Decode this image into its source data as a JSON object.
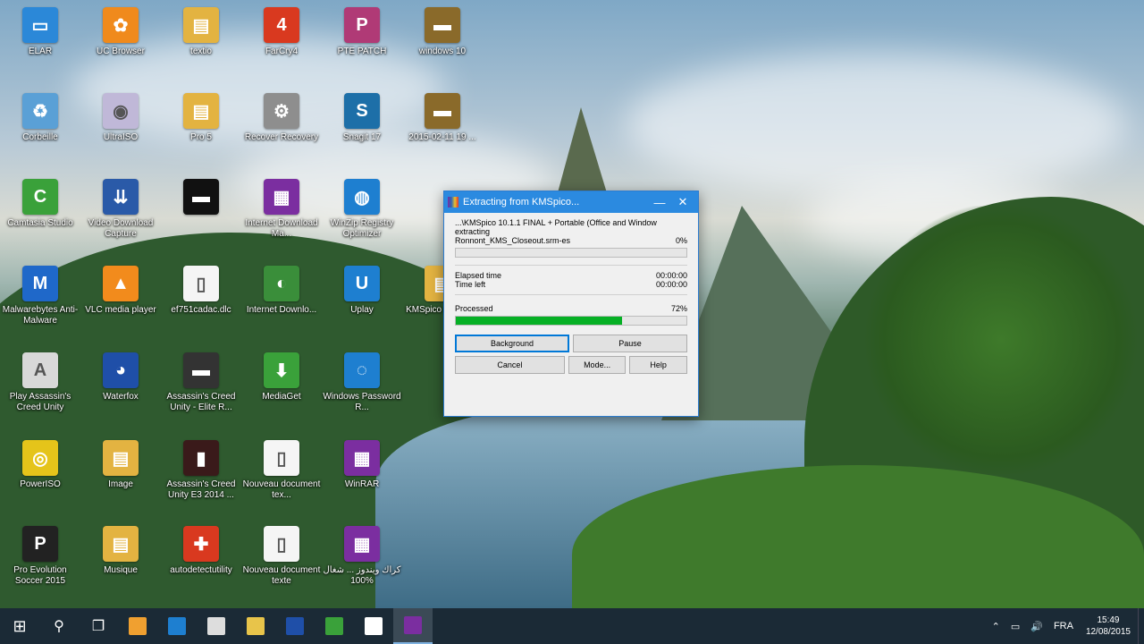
{
  "desktop_icons": [
    {
      "label": "ELAR",
      "glyph": "▭",
      "color": "#2b88d8"
    },
    {
      "label": "UC Browser",
      "glyph": "✿",
      "color": "#f08a1c"
    },
    {
      "label": "textio",
      "glyph": "▤",
      "color": "#e3b341"
    },
    {
      "label": "FarCry4",
      "glyph": "4",
      "color": "#d9391f"
    },
    {
      "label": "PTE PATCH",
      "glyph": "P",
      "color": "#b03a76"
    },
    {
      "label": "windows 10",
      "glyph": "▬",
      "color": "#8a6a2a"
    },
    {
      "label": "Corbeille",
      "glyph": "♻",
      "color": "#5aa0d6"
    },
    {
      "label": "UltraISO",
      "glyph": "◉",
      "color": "#c0b8d8"
    },
    {
      "label": "Pro 5",
      "glyph": "▤",
      "color": "#e3b341"
    },
    {
      "label": "Recover Recovery",
      "glyph": "⚙",
      "color": "#8e8e8e"
    },
    {
      "label": "Snagit 17",
      "glyph": "S",
      "color": "#1d6fa8"
    },
    {
      "label": "2015-02-11 19 ...",
      "glyph": "▬",
      "color": "#8a6a2a"
    },
    {
      "label": "Camtasia Studio",
      "glyph": "C",
      "color": "#3aa13a"
    },
    {
      "label": "Video Download Capture",
      "glyph": "⇊",
      "color": "#2a5aa8"
    },
    {
      "label": "",
      "glyph": "▬",
      "color": "#111111"
    },
    {
      "label": "Internet Download Ma...",
      "glyph": "▦",
      "color": "#7b2ea0"
    },
    {
      "label": "WinZip Registry Optimizer",
      "glyph": "◍",
      "color": "#1e7fd0"
    },
    {
      "label": "Malwarebytes Anti-Malware",
      "glyph": "M",
      "color": "#1f68c9"
    },
    {
      "label": "VLC media player",
      "glyph": "▲",
      "color": "#f28b1c"
    },
    {
      "label": "ef751cadac.dlc",
      "glyph": "▯",
      "color": "#f5f5f5"
    },
    {
      "label": "Internet Downlo...",
      "glyph": "◐",
      "color": "#3a8e3a"
    },
    {
      "label": "Uplay",
      "glyph": "U",
      "color": "#1e7fd0"
    },
    {
      "label": "KMSpico FINAL ...",
      "glyph": "▤",
      "color": "#e3b341"
    },
    {
      "label": "Play Assassin's Creed Unity",
      "glyph": "A",
      "color": "#d8d8d8"
    },
    {
      "label": "Waterfox",
      "glyph": "◕",
      "color": "#1f4fa8"
    },
    {
      "label": "Assassin's Creed Unity - Elite R...",
      "glyph": "▬",
      "color": "#333333"
    },
    {
      "label": "MediaGet",
      "glyph": "⬇",
      "color": "#3aa13a"
    },
    {
      "label": "Windows Password R...",
      "glyph": "◌",
      "color": "#1e7fd0"
    },
    {
      "label": "PowerISO",
      "glyph": "◎",
      "color": "#e5c41a"
    },
    {
      "label": "Image",
      "glyph": "▤",
      "color": "#e3b341"
    },
    {
      "label": "Assassin's Creed Unity E3 2014 ...",
      "glyph": "▮",
      "color": "#3a1a1a"
    },
    {
      "label": "Nouveau document tex...",
      "glyph": "▯",
      "color": "#f5f5f5"
    },
    {
      "label": "WinRAR",
      "glyph": "▦",
      "color": "#7b2ea0"
    },
    {
      "label": "Pro Evolution Soccer 2015",
      "glyph": "P",
      "color": "#222222"
    },
    {
      "label": "Musique",
      "glyph": "▤",
      "color": "#e3b341"
    },
    {
      "label": "autodetectutility",
      "glyph": "✚",
      "color": "#d9391f"
    },
    {
      "label": "Nouveau document texte",
      "glyph": "▯",
      "color": "#f5f5f5"
    },
    {
      "label": "كراك ويندوز ... شغال 100%",
      "glyph": "▦",
      "color": "#7b2ea0"
    }
  ],
  "dialog": {
    "title": "Extracting from KMSpico...",
    "archive_line": "...\\KMSpico 10.1.1 FINAL + Portable (Office and Window",
    "action": "extracting",
    "current_file": "Ronnont_KMS_Closeout.srm-es",
    "current_percent": "0%",
    "elapsed_label": "Elapsed time",
    "elapsed_value": "00:00:00",
    "left_label": "Time left",
    "left_value": "00:00:00",
    "processed_label": "Processed",
    "processed_percent": "72%",
    "processed_fraction": 0.72,
    "buttons": {
      "background": "Background",
      "pause": "Pause",
      "cancel": "Cancel",
      "mode": "Mode...",
      "help": "Help"
    },
    "minimize": "—",
    "close": "✕"
  },
  "taskbar": {
    "start": "⊞",
    "search": "⚲",
    "taskview": "❐",
    "pinned": [
      {
        "name": "paint-app",
        "color": "#f0a030"
      },
      {
        "name": "edge-app",
        "color": "#1e7fd0"
      },
      {
        "name": "store-app",
        "color": "#dddddd"
      },
      {
        "name": "explorer-app",
        "color": "#e8c44a"
      },
      {
        "name": "waterfox-app",
        "color": "#1f4fa8"
      },
      {
        "name": "camtasia-app",
        "color": "#3aa13a"
      },
      {
        "name": "camtasia-recorder-app",
        "color": "#ffffff"
      },
      {
        "name": "winrar-app",
        "color": "#7b2ea0"
      }
    ],
    "tray": {
      "chevron": "⌃",
      "network": "▭",
      "volume": "🔊",
      "lang": "FRA",
      "time": "15:49",
      "date": "12/08/2015"
    }
  }
}
